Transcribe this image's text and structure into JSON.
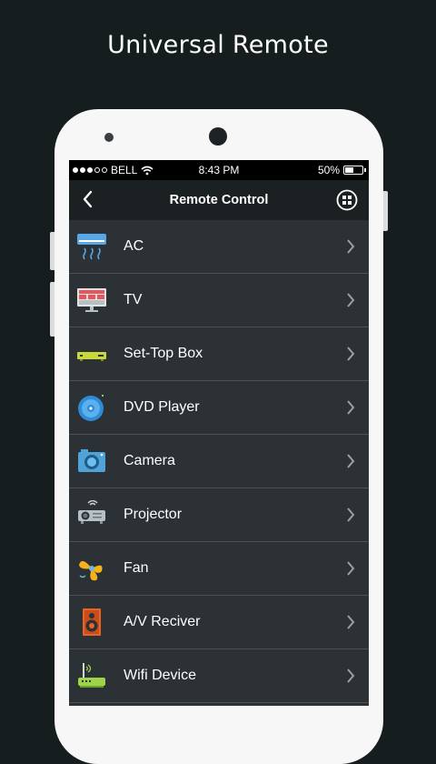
{
  "promo": {
    "title": "Universal Remote"
  },
  "status_bar": {
    "carrier": "BELL",
    "time": "8:43 PM",
    "battery": "50%"
  },
  "nav": {
    "title": "Remote Control"
  },
  "devices": [
    {
      "label": "AC",
      "icon": "air-conditioner-icon"
    },
    {
      "label": "TV",
      "icon": "tv-icon"
    },
    {
      "label": "Set-Top Box",
      "icon": "set-top-box-icon"
    },
    {
      "label": "DVD Player",
      "icon": "dvd-icon"
    },
    {
      "label": "Camera",
      "icon": "camera-icon"
    },
    {
      "label": "Projector",
      "icon": "projector-icon"
    },
    {
      "label": "Fan",
      "icon": "fan-icon"
    },
    {
      "label": "A/V Reciver",
      "icon": "speaker-icon"
    },
    {
      "label": "Wifi Device",
      "icon": "router-icon"
    }
  ],
  "colors": {
    "background": "#151d1f",
    "screen": "#2b3134",
    "navbar": "#1b2022",
    "divider": "#4a5256",
    "chevron": "#9aa0a3"
  }
}
